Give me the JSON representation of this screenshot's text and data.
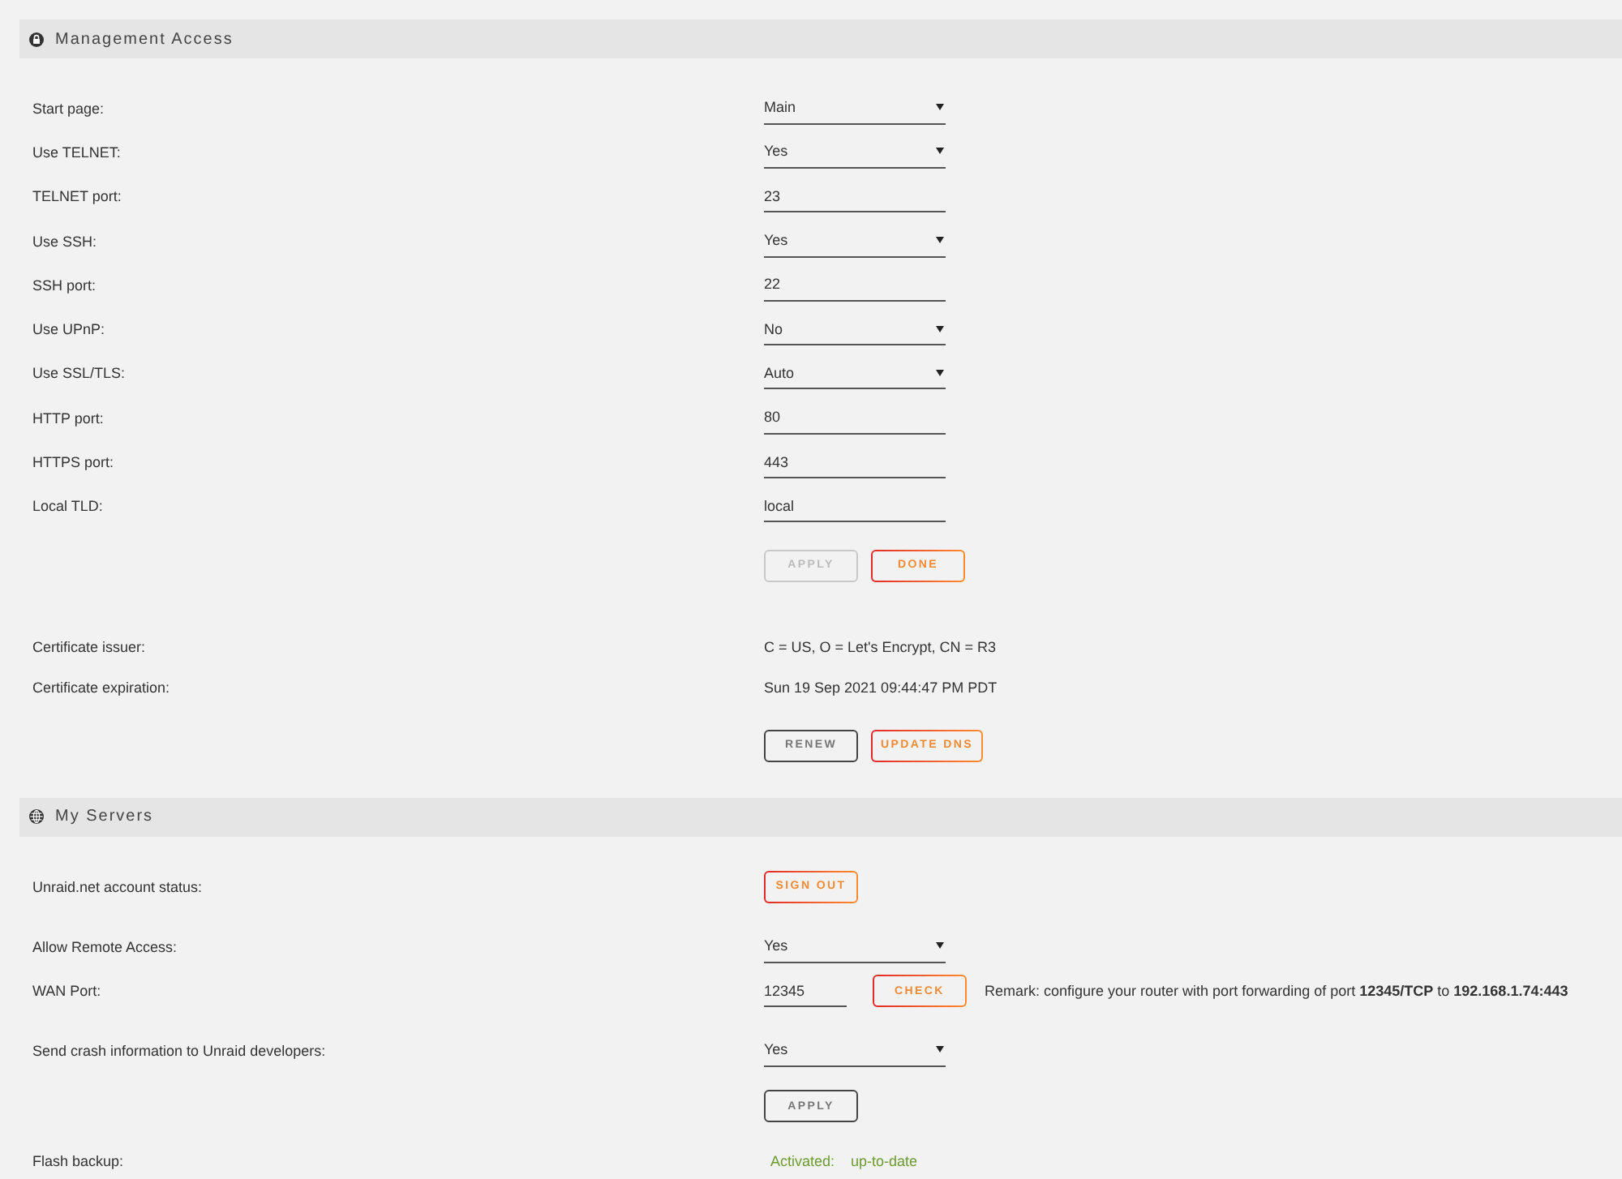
{
  "sections": [
    {
      "title": "Management Access",
      "rows": [
        {
          "kind": "select",
          "label": "Start page:",
          "value": "Main"
        },
        {
          "kind": "select",
          "label": "Use TELNET:",
          "value": "Yes"
        },
        {
          "kind": "text",
          "label": "TELNET port:",
          "value": "23"
        },
        {
          "kind": "select",
          "label": "Use SSH:",
          "value": "Yes"
        },
        {
          "kind": "text",
          "label": "SSH port:",
          "value": "22"
        },
        {
          "kind": "select",
          "label": "Use UPnP:",
          "value": "No"
        },
        {
          "kind": "select",
          "label": "Use SSL/TLS:",
          "value": "Auto"
        },
        {
          "kind": "text",
          "label": "HTTP port:",
          "value": "80"
        },
        {
          "kind": "text",
          "label": "HTTPS port:",
          "value": "443"
        },
        {
          "kind": "text",
          "label": "Local TLD:",
          "value": "local"
        },
        {
          "kind": "buttons",
          "buttons": [
            {
              "label": "APPLY",
              "kind": "plain",
              "disabled": true
            },
            {
              "label": "DONE",
              "kind": "accent",
              "disabled": false
            }
          ]
        },
        {
          "kind": "info",
          "label": "Certificate issuer:",
          "value": "C = US, O = Let's Encrypt, CN = R3"
        },
        {
          "kind": "info",
          "label": "Certificate expiration:",
          "value": "Sun 19 Sep 2021 09:44:47 PM PDT"
        },
        {
          "kind": "buttons",
          "buttons": [
            {
              "label": "RENEW",
              "kind": "plain",
              "disabled": false
            },
            {
              "label": "UPDATE DNS",
              "kind": "accent",
              "disabled": false
            }
          ]
        }
      ]
    },
    {
      "title": "My Servers",
      "rows": [
        {
          "kind": "button",
          "label": "Unraid.net account status:",
          "button": {
            "label": "SIGN OUT",
            "kind": "accent",
            "disabled": false
          }
        },
        {
          "kind": "select",
          "label": "Allow Remote Access:",
          "value": "Yes"
        },
        {
          "kind": "port_check",
          "label": "WAN Port:",
          "value": "12345",
          "button": {
            "label": "CHECK",
            "kind": "accent",
            "disabled": false
          },
          "remark": "Remark: configure your router with port forwarding of port **12345/TCP** to **192.168.1.74:443**"
        },
        {
          "kind": "select",
          "label": "Send crash information to Unraid developers:",
          "value": "Yes"
        },
        {
          "kind": "buttons",
          "buttons": [
            {
              "label": "APPLY",
              "kind": "plain",
              "disabled": false
            }
          ]
        },
        {
          "kind": "status",
          "label": "Flash backup:",
          "status": "Activated:",
          "detail": "up-to-date"
        }
      ]
    }
  ]
}
